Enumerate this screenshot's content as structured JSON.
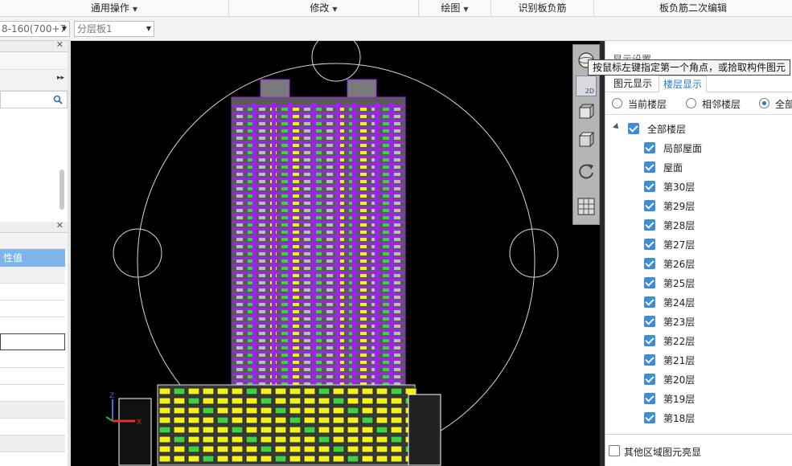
{
  "menubar": {
    "items": [
      {
        "label": "通用操作",
        "has_caret": true
      },
      {
        "label": "修改",
        "has_caret": true
      },
      {
        "label": "绘图",
        "has_caret": true
      },
      {
        "label": "识别板负筋",
        "has_caret": false
      },
      {
        "label": "板负筋二次编辑",
        "has_caret": false
      }
    ]
  },
  "toolbar": {
    "rebar_combo_value": "8-160(700+7",
    "layer_board_combo_value": "分层板1"
  },
  "left_panel": {
    "property_header_label": "性值"
  },
  "tooltip": {
    "text": "按鼠标左键指定第一个角点，或拾取构件图元"
  },
  "viewbar": {
    "mode_label": "2D"
  },
  "right_panel": {
    "title": "显示设置",
    "tabs": [
      {
        "label": "图元显示",
        "active": false
      },
      {
        "label": "楼层显示",
        "active": true
      }
    ],
    "radio_options": [
      {
        "label": "当前楼层",
        "selected": false
      },
      {
        "label": "相邻楼层",
        "selected": false
      },
      {
        "label": "全部",
        "selected": true
      }
    ],
    "tree_root": {
      "label": "全部楼层",
      "checked": true
    },
    "floors": [
      {
        "label": "局部屋面",
        "checked": true
      },
      {
        "label": "屋面",
        "checked": true
      },
      {
        "label": "第30层",
        "checked": true
      },
      {
        "label": "第29层",
        "checked": true
      },
      {
        "label": "第28层",
        "checked": true
      },
      {
        "label": "第27层",
        "checked": true
      },
      {
        "label": "第26层",
        "checked": true
      },
      {
        "label": "第25层",
        "checked": true
      },
      {
        "label": "第24层",
        "checked": true
      },
      {
        "label": "第23层",
        "checked": true
      },
      {
        "label": "第22层",
        "checked": true
      },
      {
        "label": "第21层",
        "checked": true
      },
      {
        "label": "第20层",
        "checked": true
      },
      {
        "label": "第19层",
        "checked": true
      },
      {
        "label": "第18层",
        "checked": true
      }
    ],
    "bottom_checkbox": {
      "label": "其他区域图元亮显",
      "checked": false
    }
  },
  "colors": {
    "accent": "#1f7ad1",
    "checkbox": "#3b8be0",
    "canvas_bg": "#000000",
    "tower_purple": "#9b25e8",
    "podium_yellow": "#f2f21a",
    "rebar_green": "#3fd13f"
  }
}
